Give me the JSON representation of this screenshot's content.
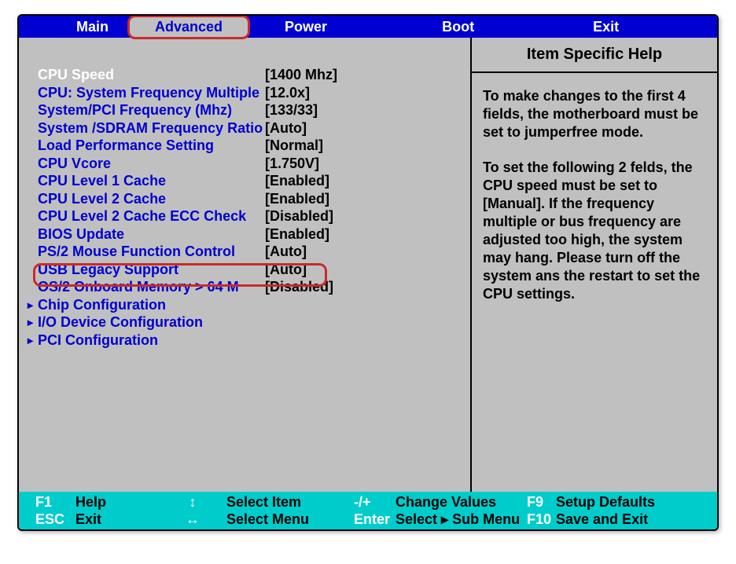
{
  "tabs": {
    "main": "Main",
    "advanced": "Advanced",
    "power": "Power",
    "boot": "Boot",
    "exit": "Exit"
  },
  "settings": [
    {
      "label": "CPU Speed",
      "value": "[1400 Mhz]",
      "selected": true
    },
    {
      "label": "CPU: System Frequency Multiple",
      "value": "[12.0x]"
    },
    {
      "label": "System/PCI Frequency (Mhz)",
      "value": "[133/33]"
    },
    {
      "label": "System /SDRAM Frequency Ratio",
      "value": "[Auto]"
    },
    {
      "label": "Load Performance Setting",
      "value": "[Normal]"
    },
    {
      "label": "CPU Vcore",
      "value": "[1.750V]"
    },
    {
      "label": "CPU Level 1 Cache",
      "value": "[Enabled]"
    },
    {
      "label": "CPU Level 2 Cache",
      "value": "[Enabled]"
    },
    {
      "label": "CPU Level 2 Cache ECC Check",
      "value": "[Disabled]"
    },
    {
      "label": "BIOS Update",
      "value": "[Enabled]"
    },
    {
      "label": "PS/2 Mouse Function Control",
      "value": "[Auto]"
    },
    {
      "label": "USB Legacy Support",
      "value": "[Auto]"
    },
    {
      "label": "OS/2 Onboard Memory > 64 M",
      "value": "[Disabled]"
    }
  ],
  "submenus": [
    "Chip Configuration",
    "I/O Device Configuration",
    "PCI Configuration"
  ],
  "help": {
    "title": "Item Specific Help",
    "p1": "To make changes to the first 4 fields, the motherboard must be set to jumperfree mode.",
    "p2": "To set the following 2 felds, the CPU speed must be set to [Manual]. If the frequency multiple or bus frequency are adjusted too high, the system may hang. Please turn off the system ans the restart to set the CPU settings."
  },
  "hints": {
    "f1": "F1",
    "help": "Help",
    "esc": "ESC",
    "exit": "Exit",
    "selectitem": "Select Item",
    "selectmenu": "Select Menu",
    "minus": "-/+",
    "changevals": "Change Values",
    "enter": "Enter",
    "selectsub": "Select ▸ Sub Menu",
    "f9": "F9",
    "setupdef": "Setup Defaults",
    "f10": "F10",
    "saveexit": "Save and Exit"
  }
}
